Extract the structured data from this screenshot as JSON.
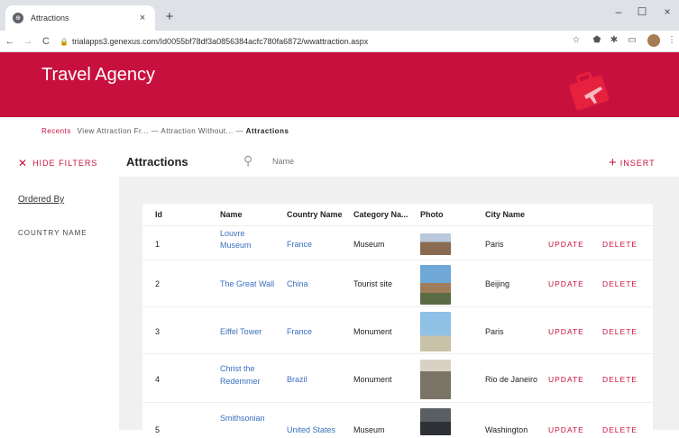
{
  "browser": {
    "tab_title": "Attractions",
    "tab_close": "×",
    "new_tab": "+",
    "url": "trialapps3.genexus.com/Id0055bf78df3a0856384acfc780fa6872/wwattraction.aspx",
    "window_controls": [
      "–",
      "☐",
      "×"
    ]
  },
  "header": {
    "brand": "Travel Agency",
    "accent": "#c8103e"
  },
  "breadcrumb": {
    "recents": "Recents",
    "items": [
      "View Attraction Fr...",
      "Attraction Without...",
      "Attractions"
    ],
    "separator": "—"
  },
  "toolbar": {
    "hide_filters": "HIDE FILTERS",
    "title": "Attractions",
    "search_placeholder": "Name",
    "insert": "INSERT"
  },
  "sidebar": {
    "ordered_by": "Ordered By",
    "filter": "COUNTRY NAME"
  },
  "table": {
    "columns": [
      "Id",
      "Name",
      "Country Name",
      "Category Na...",
      "Photo",
      "City Name"
    ],
    "update_label": "UPDATE",
    "delete_label": "DELETE",
    "rows": [
      {
        "id": "1",
        "name": [
          "Louvre",
          "Museum"
        ],
        "country": "France",
        "category": "Museum",
        "city": "Paris"
      },
      {
        "id": "2",
        "name": [
          "The Great Wall"
        ],
        "country": "China",
        "category": "Tourist site",
        "city": "Beijing"
      },
      {
        "id": "3",
        "name": [
          "Eiffel Tower"
        ],
        "country": "France",
        "category": "Monument",
        "city": "Paris"
      },
      {
        "id": "4",
        "name": [
          "Christ the",
          "Redemmer"
        ],
        "country": "Brazil",
        "category": "Monument",
        "city": "Rio de Janeiro"
      },
      {
        "id": "5",
        "name": [
          "Smithsonian"
        ],
        "country": "United States",
        "category": "Museum",
        "city": "Washington"
      }
    ]
  }
}
